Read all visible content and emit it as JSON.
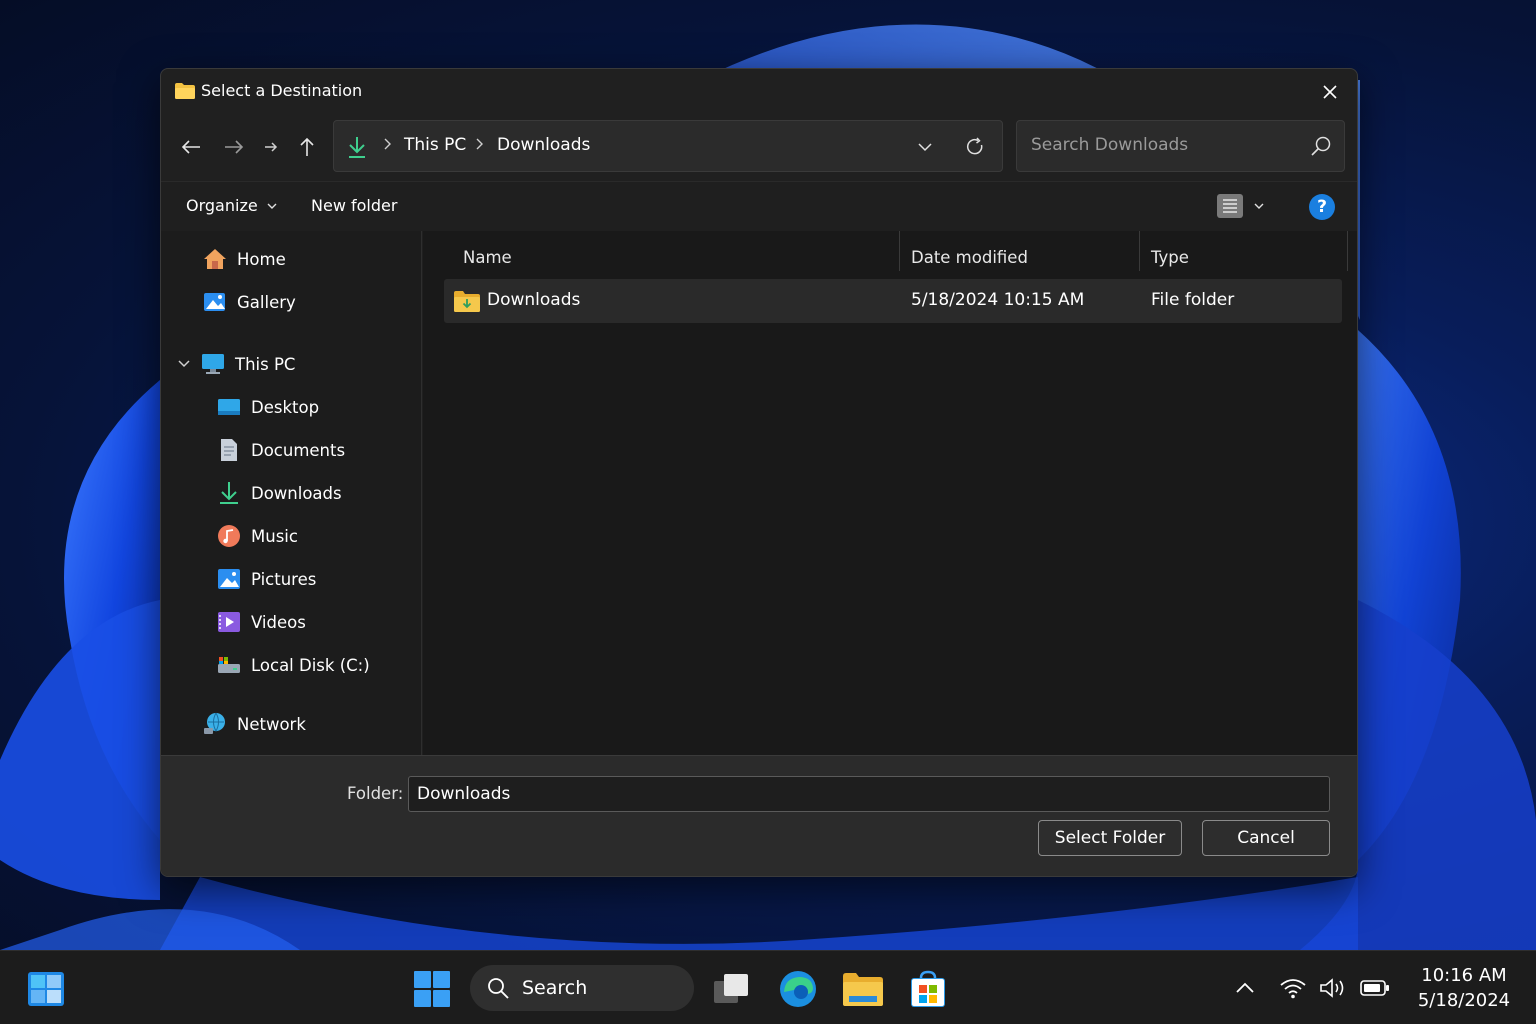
{
  "dialog": {
    "title": "Select a Destination",
    "breadcrumb": [
      "This PC",
      "Downloads"
    ],
    "search_placeholder": "Search Downloads"
  },
  "toolbar": {
    "organize_label": "Organize",
    "new_folder_label": "New folder",
    "help_label": "?"
  },
  "sidebar": {
    "items": [
      {
        "label": "Home",
        "icon": "home-icon"
      },
      {
        "label": "Gallery",
        "icon": "gallery-icon"
      },
      {
        "label": "This PC",
        "icon": "pc-icon"
      },
      {
        "label": "Desktop",
        "icon": "desktop-icon"
      },
      {
        "label": "Documents",
        "icon": "documents-icon"
      },
      {
        "label": "Downloads",
        "icon": "downloads-icon"
      },
      {
        "label": "Music",
        "icon": "music-icon"
      },
      {
        "label": "Pictures",
        "icon": "pictures-icon"
      },
      {
        "label": "Videos",
        "icon": "videos-icon"
      },
      {
        "label": "Local Disk (C:)",
        "icon": "disk-icon"
      },
      {
        "label": "Network",
        "icon": "network-icon"
      }
    ]
  },
  "files": {
    "columns": [
      "Name",
      "Date modified",
      "Type"
    ],
    "rows": [
      {
        "name": "Downloads",
        "date": "5/18/2024 10:15 AM",
        "type": "File folder"
      }
    ]
  },
  "footer": {
    "folder_label": "Folder:",
    "folder_value": "Downloads",
    "select_button": "Select Folder",
    "cancel_button": "Cancel"
  },
  "taskbar": {
    "search_label": "Search",
    "time": "10:16 AM",
    "date": "5/18/2024"
  },
  "colors": {
    "accent": "#1a7fe0",
    "dialog_bg": "#202020",
    "folder_yellow": "#f3c242",
    "download_green": "#3fcf8e"
  }
}
